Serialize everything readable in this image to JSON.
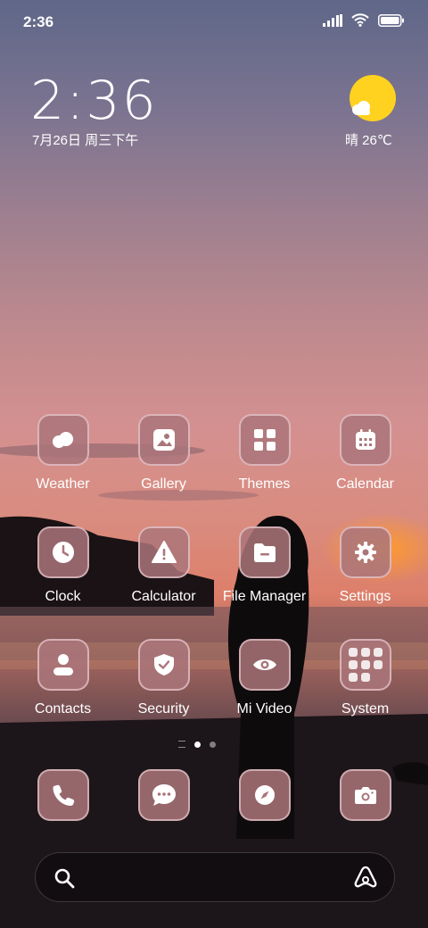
{
  "status_bar": {
    "time": "2:36"
  },
  "clock": {
    "time": "2:36",
    "date": "7月26日 周三下午"
  },
  "weather": {
    "text": "晴 26℃",
    "sun_color": "#ffd21f"
  },
  "apps": [
    {
      "label": "Weather",
      "icon": "weather-icon"
    },
    {
      "label": "Gallery",
      "icon": "gallery-icon"
    },
    {
      "label": "Themes",
      "icon": "themes-icon"
    },
    {
      "label": "Calendar",
      "icon": "calendar-icon"
    },
    {
      "label": "Clock",
      "icon": "clock-icon"
    },
    {
      "label": "Calculator",
      "icon": "calculator-icon"
    },
    {
      "label": "File Manager",
      "icon": "file-manager-icon"
    },
    {
      "label": "Settings",
      "icon": "settings-icon"
    },
    {
      "label": "Contacts",
      "icon": "contacts-icon"
    },
    {
      "label": "Security",
      "icon": "security-icon"
    },
    {
      "label": "Mi Video",
      "icon": "mi-video-icon"
    },
    {
      "label": "System",
      "icon": "system-folder-icon"
    }
  ],
  "dock": [
    {
      "icon": "phone-icon"
    },
    {
      "icon": "messages-icon"
    },
    {
      "icon": "browser-icon"
    },
    {
      "icon": "camera-icon"
    }
  ],
  "icon_tile_color": "#aa767a"
}
